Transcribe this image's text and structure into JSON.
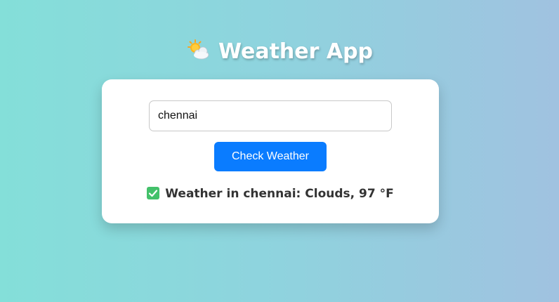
{
  "app": {
    "title": "Weather App",
    "title_icon": "sun-behind-cloud-icon"
  },
  "search": {
    "value": "chennai",
    "button_label": "Check Weather"
  },
  "result": {
    "icon": "check-mark-icon",
    "text": "Weather in chennai: Clouds, 97 °F"
  },
  "colors": {
    "button": "#0a7cff",
    "check_badge": "#43c16a"
  }
}
